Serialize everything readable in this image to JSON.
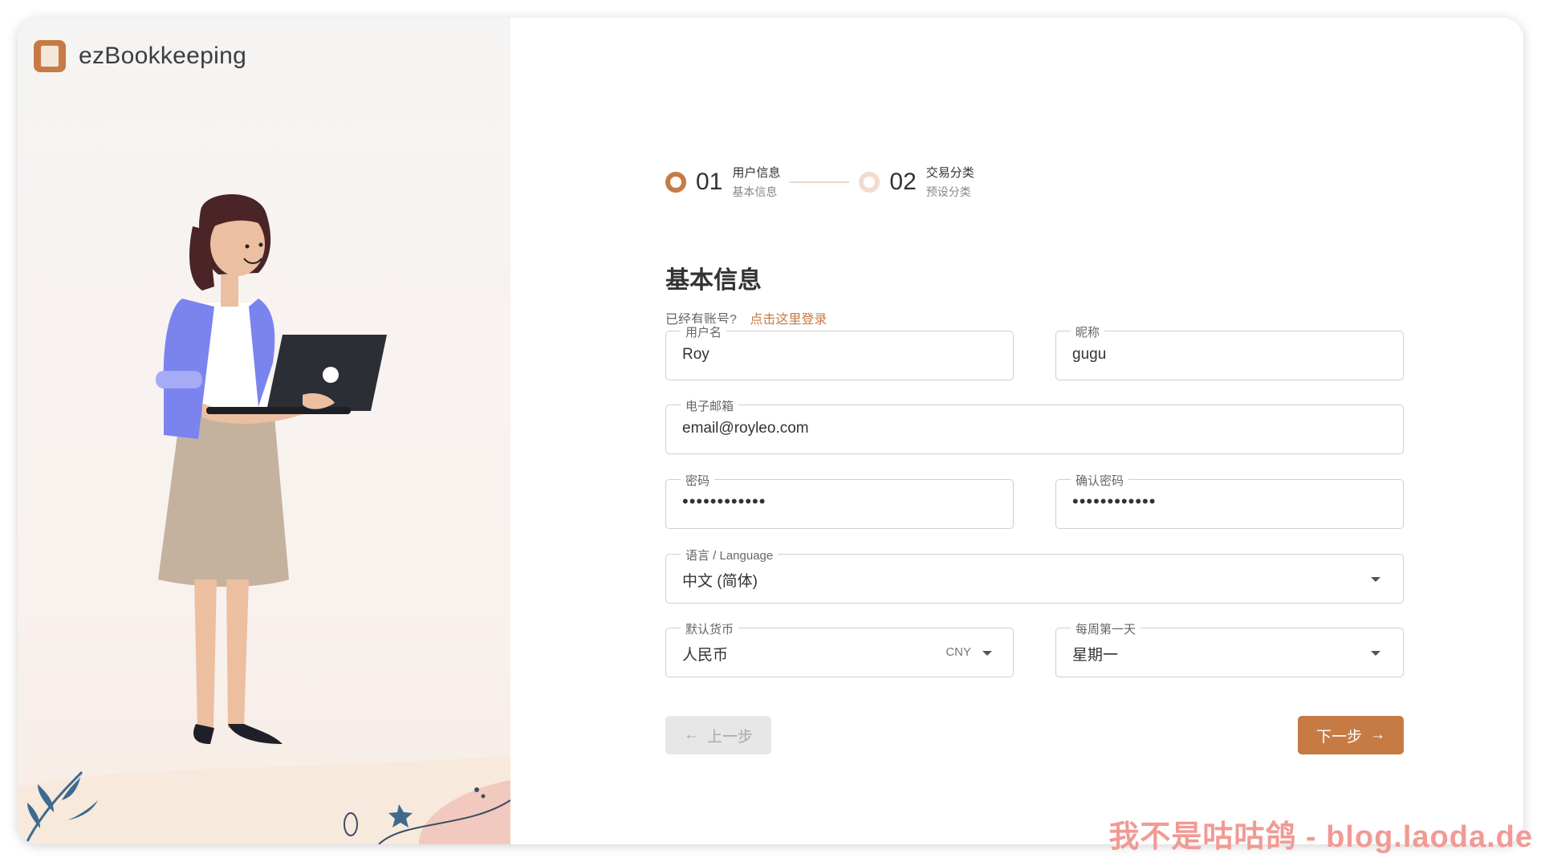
{
  "app": {
    "title": "ezBookkeeping"
  },
  "stepper": {
    "steps": [
      {
        "number": "01",
        "title": "用户信息",
        "subtitle": "基本信息"
      },
      {
        "number": "02",
        "title": "交易分类",
        "subtitle": "预设分类"
      }
    ]
  },
  "form": {
    "title": "基本信息",
    "login_prompt": "已经有账号?",
    "login_link": "点击这里登录",
    "username": {
      "label": "用户名",
      "value": "Roy"
    },
    "nickname": {
      "label": "昵称",
      "value": "gugu"
    },
    "email": {
      "label": "电子邮箱",
      "value": "email@royleo.com"
    },
    "password": {
      "label": "密码",
      "value": "••••••••••••"
    },
    "confirm_password": {
      "label": "确认密码",
      "value": "••••••••••••"
    },
    "language": {
      "label": "语言 / Language",
      "value": "中文 (简体)"
    },
    "currency": {
      "label": "默认货币",
      "value": "人民币",
      "code": "CNY"
    },
    "first_day": {
      "label": "每周第一天",
      "value": "星期一"
    }
  },
  "buttons": {
    "prev": "上一步",
    "next": "下一步"
  },
  "watermark": "我不是咕咕鸽 - blog.laoda.de",
  "colors": {
    "accent": "#c67b45",
    "watermark": "#f19a94"
  }
}
